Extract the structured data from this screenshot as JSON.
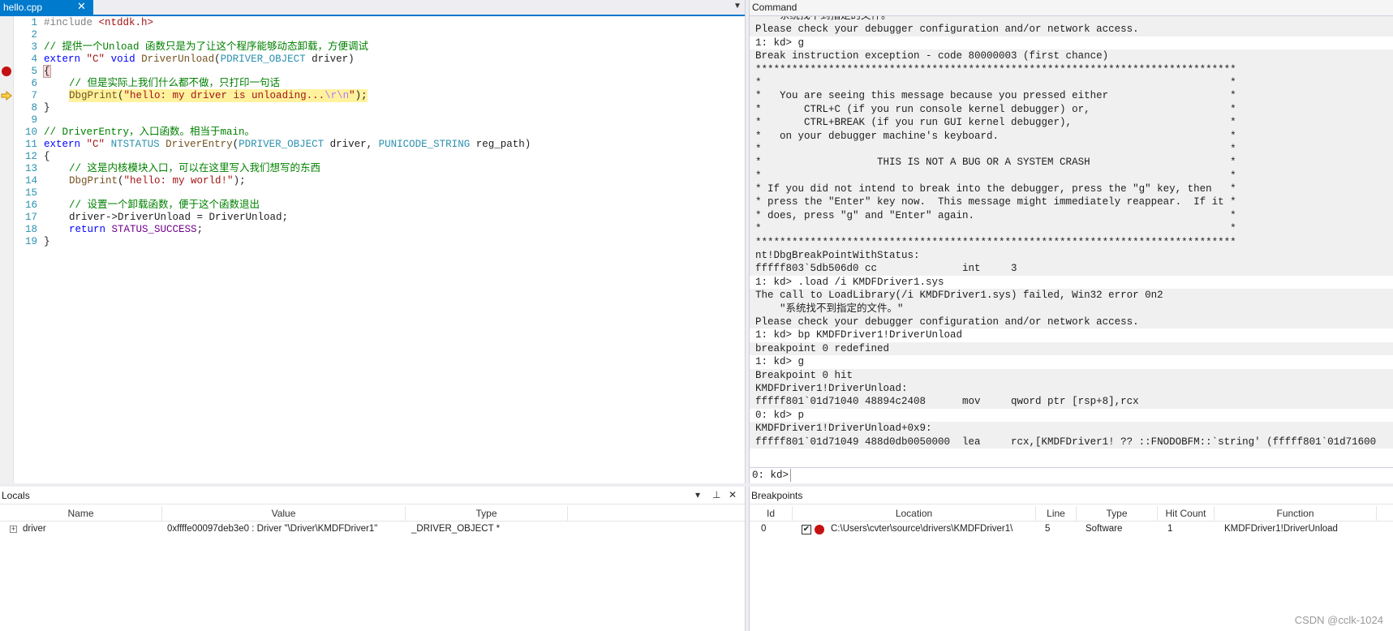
{
  "editor": {
    "tab_label": "hello.cpp",
    "tab_close": "✕",
    "dropdown_icon": "▼",
    "lines": [
      {
        "n": "1"
      },
      {
        "n": "2"
      },
      {
        "n": "3"
      },
      {
        "n": "4"
      },
      {
        "n": "5"
      },
      {
        "n": "6"
      },
      {
        "n": "7"
      },
      {
        "n": "8"
      },
      {
        "n": "9"
      },
      {
        "n": "10"
      },
      {
        "n": "11"
      },
      {
        "n": "12"
      },
      {
        "n": "13"
      },
      {
        "n": "14"
      },
      {
        "n": "15"
      },
      {
        "n": "16"
      },
      {
        "n": "17"
      },
      {
        "n": "18"
      },
      {
        "n": "19"
      }
    ],
    "code": {
      "l1_directive": "#include",
      "l1_header": "<ntddk.h>",
      "l3_comment": "// 提供一个Unload 函数只是为了让这个程序能够动态卸载，方便调试",
      "l4_extern": "extern",
      "l4_c": "\"C\"",
      "l4_void": "void",
      "l4_fn": "DriverUnload",
      "l4_open": "(",
      "l4_type": "PDRIVER_OBJECT",
      "l4_rest": " driver)",
      "l5_brace": "{",
      "l6_comment": "// 但是实际上我们什么都不做，只打印一句话",
      "l7_fn": "DbgPrint",
      "l7_open": "(",
      "l7_str": "\"hello: my driver is unloading...",
      "l7_esc": "\\r\\n",
      "l7_strend": "\"",
      "l7_close": ");",
      "l8_brace": "}",
      "l10_comment": "// DriverEntry，入口函数。相当于main。",
      "l11_extern": "extern",
      "l11_c": "\"C\"",
      "l11_type": "NTSTATUS",
      "l11_fn": "DriverEntry",
      "l11_open": "(",
      "l11_type2": "PDRIVER_OBJECT",
      "l11_mid": " driver, ",
      "l11_type3": "PUNICODE_STRING",
      "l11_rest": " reg_path)",
      "l12_brace": "{",
      "l13_comment": "// 这是内核模块入口，可以在这里写入我们想写的东西",
      "l14_fn": "DbgPrint",
      "l14_open": "(",
      "l14_str": "\"hello: my world!\"",
      "l14_close": ");",
      "l16_comment": "// 设置一个卸载函数，便于这个函数退出",
      "l17_code": "driver->DriverUnload = DriverUnload;",
      "l18_kw": "return",
      "l18_macro": "STATUS_SUCCESS",
      "l18_end": ";",
      "l19_brace": "}"
    }
  },
  "command": {
    "title": "Command",
    "lines": [
      {
        "t": "    系统找不到指定的文件。",
        "k": "resp cut"
      },
      {
        "t": "Please check your debugger configuration and/or network access.",
        "k": "resp"
      },
      {
        "t": "1: kd> g",
        "k": "prompt"
      },
      {
        "t": "Break instruction exception - code 80000003 (first chance)",
        "k": "resp"
      },
      {
        "t": "*******************************************************************************",
        "k": "resp"
      },
      {
        "t": "*                                                                             *",
        "k": "resp"
      },
      {
        "t": "*   You are seeing this message because you pressed either                    *",
        "k": "resp"
      },
      {
        "t": "*       CTRL+C (if you run console kernel debugger) or,                       *",
        "k": "resp"
      },
      {
        "t": "*       CTRL+BREAK (if you run GUI kernel debugger),                          *",
        "k": "resp"
      },
      {
        "t": "*   on your debugger machine's keyboard.                                      *",
        "k": "resp"
      },
      {
        "t": "*                                                                             *",
        "k": "resp"
      },
      {
        "t": "*                   THIS IS NOT A BUG OR A SYSTEM CRASH                       *",
        "k": "resp"
      },
      {
        "t": "*                                                                             *",
        "k": "resp"
      },
      {
        "t": "* If you did not intend to break into the debugger, press the \"g\" key, then   *",
        "k": "resp"
      },
      {
        "t": "* press the \"Enter\" key now.  This message might immediately reappear.  If it *",
        "k": "resp"
      },
      {
        "t": "* does, press \"g\" and \"Enter\" again.                                          *",
        "k": "resp"
      },
      {
        "t": "*                                                                             *",
        "k": "resp"
      },
      {
        "t": "*******************************************************************************",
        "k": "resp"
      },
      {
        "t": "nt!DbgBreakPointWithStatus:",
        "k": "resp"
      },
      {
        "t": "fffff803`5db506d0 cc              int     3",
        "k": "resp"
      },
      {
        "t": "1: kd> .load /i KMDFDriver1.sys",
        "k": "prompt"
      },
      {
        "t": "The call to LoadLibrary(/i KMDFDriver1.sys) failed, Win32 error 0n2",
        "k": "resp"
      },
      {
        "t": "    \"系统找不到指定的文件。\"",
        "k": "resp"
      },
      {
        "t": "Please check your debugger configuration and/or network access.",
        "k": "resp"
      },
      {
        "t": "1: kd> bp KMDFDriver1!DriverUnload",
        "k": "prompt"
      },
      {
        "t": "breakpoint 0 redefined",
        "k": "resp"
      },
      {
        "t": "1: kd> g",
        "k": "prompt"
      },
      {
        "t": "Breakpoint 0 hit",
        "k": "resp"
      },
      {
        "t": "KMDFDriver1!DriverUnload:",
        "k": "resp"
      },
      {
        "t": "fffff801`01d71040 48894c2408      mov     qword ptr [rsp+8],rcx",
        "k": "resp"
      },
      {
        "t": "0: kd> p",
        "k": "prompt"
      },
      {
        "t": "KMDFDriver1!DriverUnload+0x9:",
        "k": "resp"
      },
      {
        "t": "fffff801`01d71049 488d0db0050000  lea     rcx,[KMDFDriver1! ?? ::FNODOBFM::`string' (fffff801`01d71600",
        "k": "resp"
      }
    ],
    "prompt": "0: kd>",
    "input_value": ""
  },
  "locals": {
    "title": "Locals",
    "columns": {
      "name": "Name",
      "value": "Value",
      "type": "Type"
    },
    "rows": [
      {
        "expander": "+",
        "name": "driver",
        "value": "0xffffe00097deb3e0 : Driver \"\\Driver\\KMDFDriver1\"",
        "type": "_DRIVER_OBJECT *"
      }
    ],
    "buttons": {
      "dropdown": "▾",
      "pin": "⊥",
      "close": "✕"
    }
  },
  "breakpoints": {
    "title": "Breakpoints",
    "columns": {
      "id": "Id",
      "location": "Location",
      "line": "Line",
      "type": "Type",
      "hit": "Hit Count",
      "function": "Function"
    },
    "rows": [
      {
        "id": "0",
        "checked": "✔",
        "location": "C:\\Users\\cvter\\source\\drivers\\KMDFDriver1\\",
        "line": "5",
        "type": "Software",
        "hit": "1",
        "function": "KMDFDriver1!DriverUnload"
      }
    ]
  },
  "watermark": "CSDN @cclk-1024",
  "colors": {
    "accent": "#007acc",
    "breakpoint": "#c51111",
    "current_line": "#fff29d"
  }
}
